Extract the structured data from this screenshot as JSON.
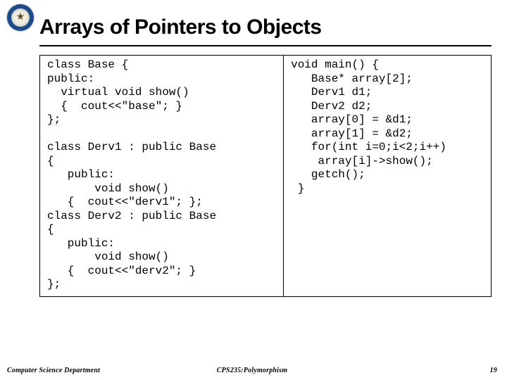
{
  "slide": {
    "title": "Arrays of Pointers to Objects"
  },
  "code": {
    "left": "class Base {\npublic:\n  virtual void show()\n  {  cout<<\"base\"; }\n};\n\nclass Derv1 : public Base\n{\n   public:\n       void show()\n   {  cout<<\"derv1\"; };\nclass Derv2 : public Base\n{\n   public:\n       void show()\n   {  cout<<\"derv2\"; }\n};",
    "right": "void main() {\n   Base* array[2];\n   Derv1 d1;\n   Derv2 d2;\n   array[0] = &d1;\n   array[1] = &d2;\n   for(int i=0;i<2;i++)\n    array[i]->show();\n   getch();\n }"
  },
  "footer": {
    "left": "Computer Science Department",
    "center": "CPS235:Polymorphism",
    "right": "19"
  }
}
